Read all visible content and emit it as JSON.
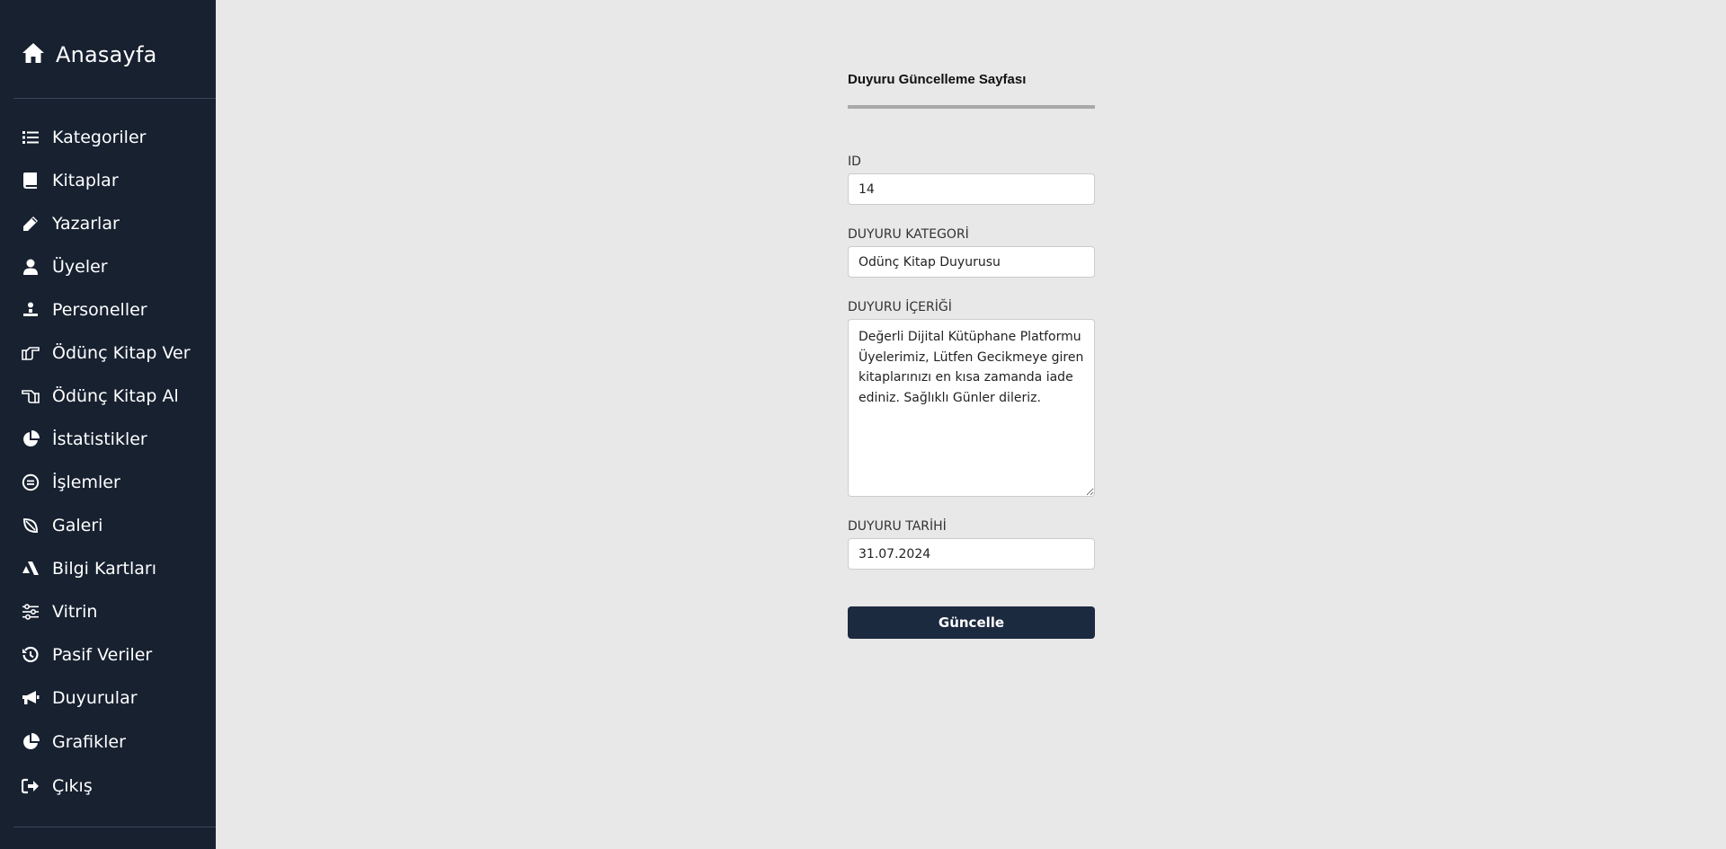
{
  "sidebar": {
    "brand": {
      "label": "Anasayfa",
      "icon": "home-icon"
    },
    "items": [
      {
        "label": "Kategoriler",
        "icon": "list-icon"
      },
      {
        "label": "Kitaplar",
        "icon": "book-icon"
      },
      {
        "label": "Yazarlar",
        "icon": "pencil-icon"
      },
      {
        "label": "Üyeler",
        "icon": "user-icon"
      },
      {
        "label": "Personeller",
        "icon": "staff-icon"
      },
      {
        "label": "Ödünç Kitap Ver",
        "icon": "hand-point-right-icon"
      },
      {
        "label": "Ödünç Kitap Al",
        "icon": "hand-point-left-icon"
      },
      {
        "label": "İstatistikler",
        "icon": "pie-chart-icon"
      },
      {
        "label": "İşlemler",
        "icon": "circle-list-icon"
      },
      {
        "label": "Galeri",
        "icon": "leaf-icon"
      },
      {
        "label": "Bilgi Kartları",
        "icon": "cards-icon"
      },
      {
        "label": "Vitrin",
        "icon": "sliders-icon"
      },
      {
        "label": "Pasif Veriler",
        "icon": "history-icon"
      },
      {
        "label": "Duyurular",
        "icon": "megaphone-icon"
      },
      {
        "label": "Grafikler",
        "icon": "pie-chart-icon"
      },
      {
        "label": "Çıkış",
        "icon": "logout-icon"
      }
    ]
  },
  "form": {
    "title": "Duyuru Güncelleme Sayfası",
    "id_label": "ID",
    "id_value": "14",
    "category_label": "DUYURU KATEGORİ",
    "category_value": "Ödünç Kitap Duyurusu",
    "content_label": "DUYURU İÇERİĞİ",
    "content_value": "Değerli Dijital Kütüphane Platformu Üyelerimiz, Lütfen Gecikmeye giren kitaplarınızı en kısa zamanda iade ediniz. Sağlıklı Günler dileriz.",
    "date_label": "DUYURU TARİHİ",
    "date_value": "31.07.2024",
    "submit_label": "Güncelle"
  },
  "colors": {
    "sidebar_bg": "#172130",
    "page_bg": "#e8e8e8",
    "button_bg": "#1c2a40",
    "title_rule": "#a9a9a9"
  }
}
